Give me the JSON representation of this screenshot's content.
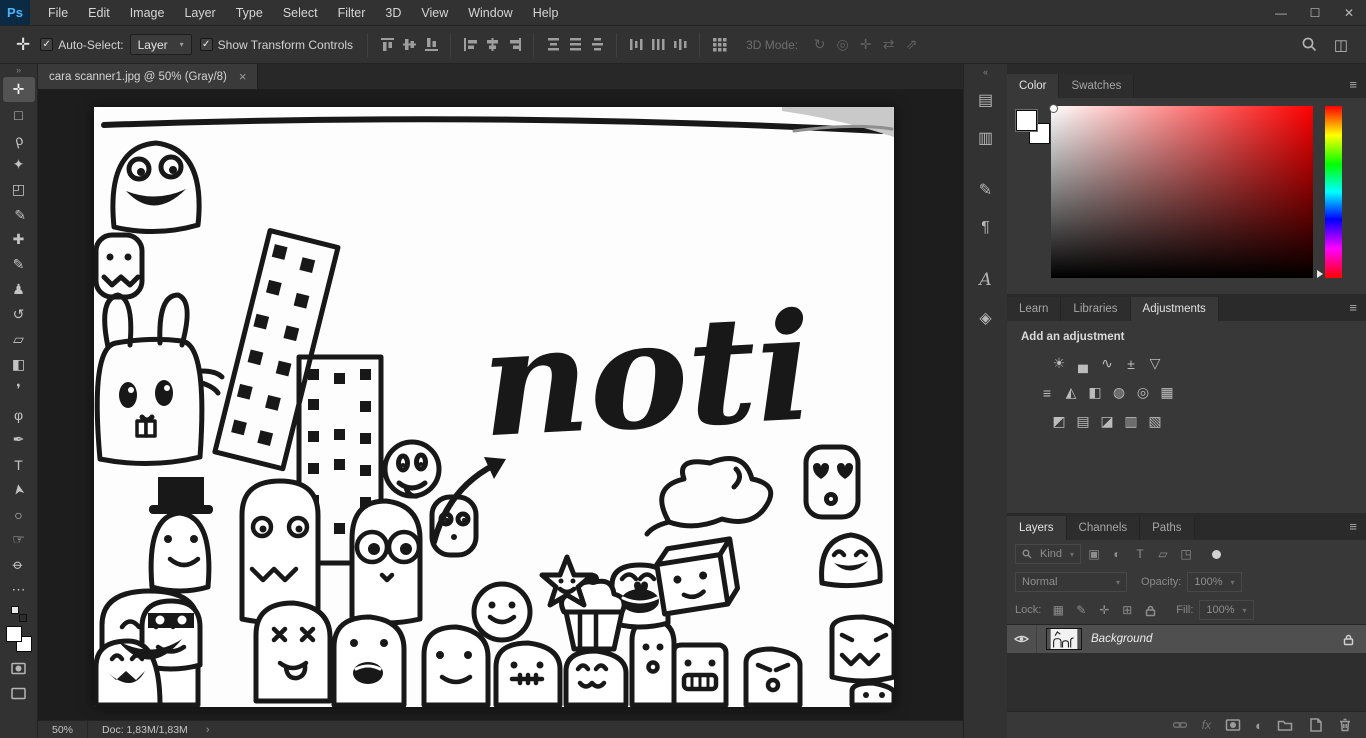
{
  "app": {
    "logo": "Ps",
    "window_controls": {
      "minimize": "—",
      "restore": "☐",
      "close": "✕"
    }
  },
  "ui": {
    "chevron_down": "▾"
  },
  "menu_bar": {
    "items": [
      "File",
      "Edit",
      "Image",
      "Layer",
      "Type",
      "Select",
      "Filter",
      "3D",
      "View",
      "Window",
      "Help"
    ]
  },
  "options_bar": {
    "tool_glyph": "✛",
    "auto_select": {
      "label": "Auto-Select:",
      "value": "Layer",
      "check": "✓"
    },
    "show_transform": {
      "label": "Show Transform Controls",
      "check": "✓"
    },
    "mode_3d": {
      "label": "3D Mode:",
      "icons": [
        {
          "name": "3d-orbit",
          "glyph": "↻"
        },
        {
          "name": "3d-roll",
          "glyph": "◎"
        },
        {
          "name": "3d-pan",
          "glyph": "✛"
        },
        {
          "name": "3d-slide",
          "glyph": "⇄"
        },
        {
          "name": "3d-scale",
          "glyph": "⇗"
        }
      ]
    },
    "workspace_glyph": "◫"
  },
  "toolbar": {
    "collapse_glyph": "»",
    "tools": [
      {
        "name": "move-tool",
        "glyph": "✛",
        "selected": true
      },
      {
        "name": "rectangular-marquee-tool",
        "glyph": "□"
      },
      {
        "name": "lasso-tool",
        "glyph": "ρ"
      },
      {
        "name": "quick-selection-tool",
        "glyph": "✦"
      },
      {
        "name": "crop-tool",
        "glyph": "◰"
      },
      {
        "name": "eyedropper-tool",
        "glyph": "✐"
      },
      {
        "name": "spot-healing-brush-tool",
        "glyph": "✚"
      },
      {
        "name": "brush-tool",
        "glyph": "✎"
      },
      {
        "name": "clone-stamp-tool",
        "glyph": "♟"
      },
      {
        "name": "history-brush-tool",
        "glyph": "↺"
      },
      {
        "name": "eraser-tool",
        "glyph": "▱"
      },
      {
        "name": "gradient-tool",
        "glyph": "◧"
      },
      {
        "name": "blur-tool",
        "glyph": "❜"
      },
      {
        "name": "dodge-tool",
        "glyph": "φ"
      },
      {
        "name": "pen-tool",
        "glyph": "✒"
      },
      {
        "name": "type-tool",
        "glyph": "T"
      },
      {
        "name": "path-selection-tool",
        "glyph": "➤"
      },
      {
        "name": "ellipse-tool",
        "glyph": "○"
      },
      {
        "name": "hand-tool",
        "glyph": "☞"
      },
      {
        "name": "zoom-tool",
        "glyph": "⌀"
      },
      {
        "name": "edit-toolbar",
        "glyph": "⋯"
      }
    ]
  },
  "document": {
    "tab_title": "cara scanner1.jpg @ 50% (Gray/8)",
    "tab_close": "×",
    "artwork_text": "noti",
    "status": {
      "zoom": "50%",
      "doc_size": "Doc: 1,83M/1,83M",
      "chevron": "›"
    }
  },
  "panel_strip": {
    "collapse_glyph": "«",
    "icons": [
      {
        "name": "properties-panel",
        "glyph": "▤"
      },
      {
        "name": "swatches-panel",
        "glyph": "▥"
      },
      {
        "name": "brush-settings-panel",
        "glyph": "✎"
      },
      {
        "name": "paragraph-panel",
        "glyph": "¶"
      },
      {
        "name": "character-panel",
        "glyph": "A"
      },
      {
        "name": "3d-panel",
        "glyph": "◈"
      }
    ]
  },
  "panels": {
    "menu_glyph": "≡",
    "color": {
      "tabs": [
        "Color",
        "Swatches"
      ],
      "active_tab": "Color"
    },
    "adjustments": {
      "tabs": [
        "Learn",
        "Libraries",
        "Adjustments"
      ],
      "active_tab": "Adjustments",
      "header": "Add an adjustment",
      "rows": [
        [
          {
            "name": "brightness-contrast",
            "glyph": "☀"
          },
          {
            "name": "levels",
            "glyph": "▄"
          },
          {
            "name": "curves",
            "glyph": "∿"
          },
          {
            "name": "exposure",
            "glyph": "±"
          },
          {
            "name": "vibrance",
            "glyph": "▽"
          }
        ],
        [
          {
            "name": "hue-saturation",
            "glyph": "≡"
          },
          {
            "name": "color-balance",
            "glyph": "◭"
          },
          {
            "name": "black-and-white",
            "glyph": "◧"
          },
          {
            "name": "photo-filter",
            "glyph": "◍"
          },
          {
            "name": "channel-mixer",
            "glyph": "◎"
          },
          {
            "name": "color-lookup",
            "glyph": "▦"
          }
        ],
        [
          {
            "name": "invert",
            "glyph": "◩"
          },
          {
            "name": "posterize",
            "glyph": "▤"
          },
          {
            "name": "threshold",
            "glyph": "◪"
          },
          {
            "name": "gradient-map",
            "glyph": "▥"
          },
          {
            "name": "selective-color",
            "glyph": "▧"
          }
        ]
      ]
    },
    "layers": {
      "tabs": [
        "Layers",
        "Channels",
        "Paths"
      ],
      "active_tab": "Layers",
      "filter_label": "Kind",
      "filter_icons": [
        {
          "name": "filter-pixel-layers",
          "glyph": "▣"
        },
        {
          "name": "filter-adjustment-layers",
          "glyph": "◐"
        },
        {
          "name": "filter-type-layers",
          "glyph": "T"
        },
        {
          "name": "filter-shape-layers",
          "glyph": "▱"
        },
        {
          "name": "filter-smart-objects",
          "glyph": "◳"
        }
      ],
      "blend_mode": "Normal",
      "opacity_label": "Opacity:",
      "opacity_value": "100%",
      "lock_label": "Lock:",
      "lock_icons": [
        {
          "name": "lock-transparency",
          "glyph": "▦"
        },
        {
          "name": "lock-pixels",
          "glyph": "✎"
        },
        {
          "name": "lock-position",
          "glyph": "✛"
        },
        {
          "name": "lock-artboard",
          "glyph": "⊞"
        }
      ],
      "fill_label": "Fill:",
      "fill_value": "100%",
      "fx_label": "fx",
      "layers": [
        {
          "name": "Background"
        }
      ]
    }
  }
}
